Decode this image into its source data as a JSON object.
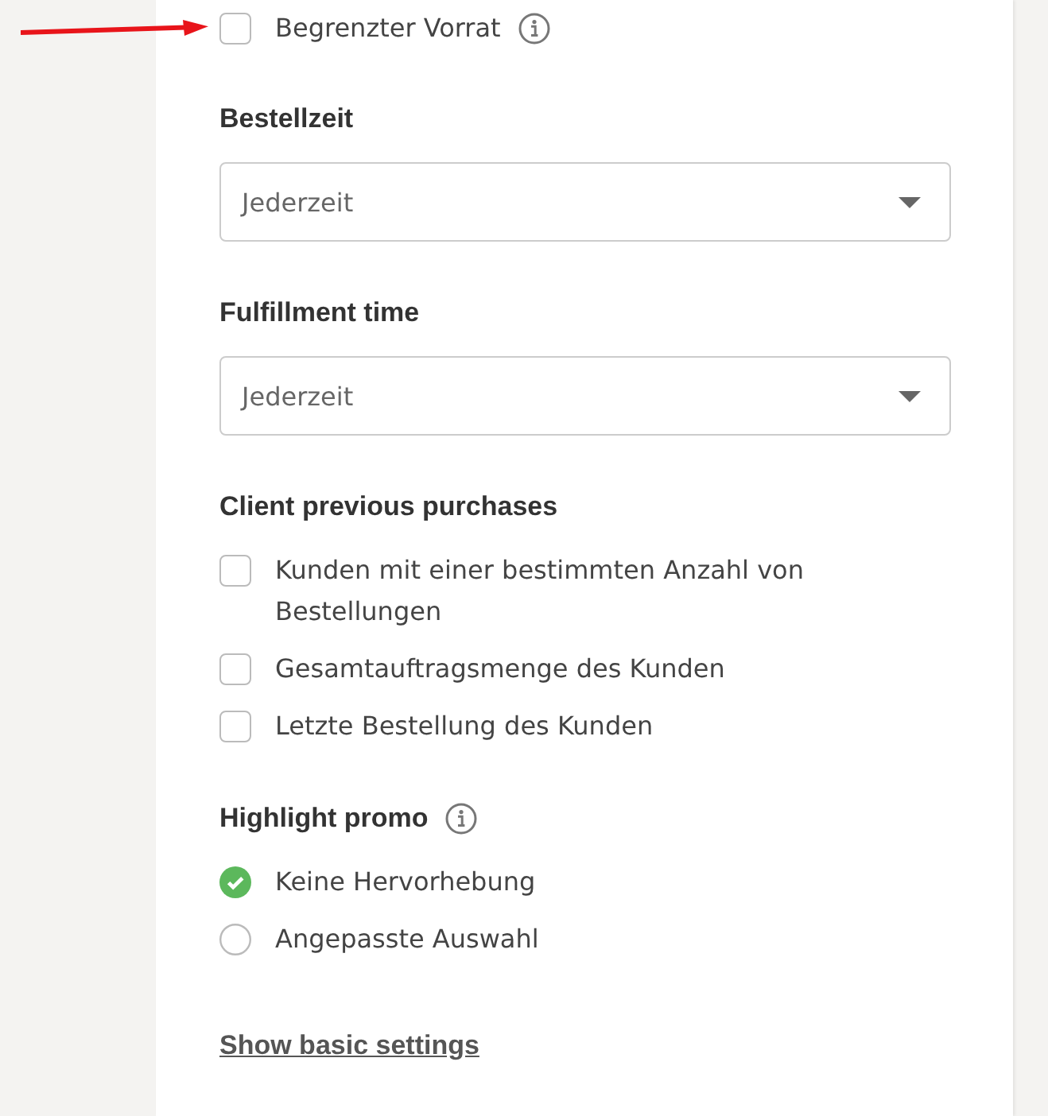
{
  "sections": [
    {
      "kind": "checkbox",
      "label": "Begrenzter Vorrat",
      "checked": false,
      "info": true
    },
    {
      "kind": "select",
      "label": "Bestellzeit",
      "value": "Jederzeit"
    },
    {
      "kind": "select",
      "label": "Fulfillment time",
      "value": "Jederzeit"
    },
    {
      "kind": "checkbox_group",
      "label": "Client previous purchases",
      "options": [
        {
          "label": "Kunden mit einer bestimmten Anzahl von Bestellungen",
          "checked": false
        },
        {
          "label": "Gesamtauftragsmenge des Kunden",
          "checked": false
        },
        {
          "label": "Letzte Bestellung des Kunden",
          "checked": false
        }
      ]
    },
    {
      "kind": "radio_group",
      "label": "Highlight promo",
      "info": true,
      "options": [
        {
          "label": "Keine Hervorhebung",
          "selected": true
        },
        {
          "label": "Angepasste Auswahl",
          "selected": false
        }
      ]
    },
    {
      "kind": "link",
      "label": "Show basic settings"
    }
  ]
}
